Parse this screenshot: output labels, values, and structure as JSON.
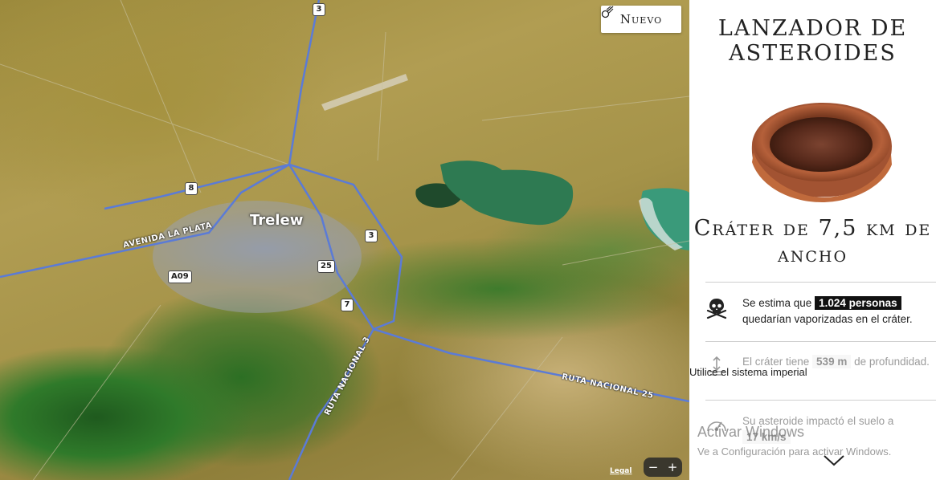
{
  "map": {
    "city_label": "Trelew",
    "road_labels": {
      "avenida": "AVENIDA LA PLATA",
      "ruta3": "RUTA NACIONAL 3",
      "ruta25": "RUTA NACIONAL 25"
    },
    "shields": {
      "s3_top": "3",
      "s8": "8",
      "s3_mid": "3",
      "s25": "25",
      "s7": "7",
      "a09": "A09"
    },
    "legal_label": "Legal",
    "zoom_out_label": "−",
    "zoom_in_label": "+"
  },
  "toolbar": {
    "nuevo_label": "Nuevo",
    "nuevo_icon": "asteroid-icon"
  },
  "panel": {
    "title": "LANZADOR DE ASTEROIDES",
    "crater_size": "Cráter de 7,5 km de ancho",
    "stats": [
      {
        "icon": "skull-crossbones-icon",
        "pre": "Se estima que ",
        "highlight": "1.024 personas",
        "post": " quedarían vaporizadas en el cráter."
      },
      {
        "icon": "depth-gauge-icon",
        "pre": "El cráter tiene ",
        "highlight": "539 m",
        "post": " de profundidad."
      },
      {
        "icon": "speedometer-icon",
        "pre": "Su asteroide impactó el suelo a ",
        "highlight": "17 km/s",
        "post": ""
      }
    ],
    "imperial_link": "Utilice el sistema imperial"
  },
  "watermark": {
    "line1": "Activar Windows",
    "line2": "Ve a Configuración para activar Windows."
  },
  "colors": {
    "highlight_dark": "#111111",
    "road_blue": "#5b7bd6"
  }
}
